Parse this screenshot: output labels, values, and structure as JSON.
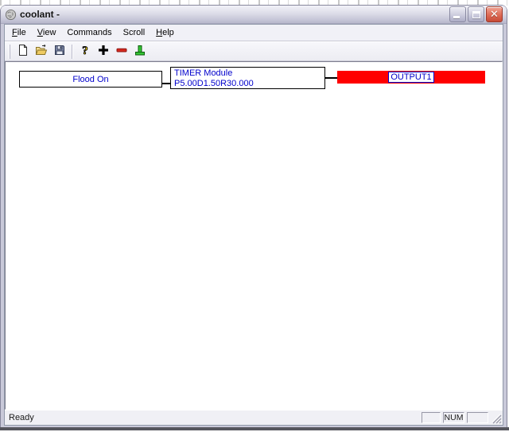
{
  "window": {
    "title": "coolant -",
    "controls": [
      {
        "name": "minimize",
        "icon": "minimize-icon"
      },
      {
        "name": "maximize",
        "icon": "maximize-icon"
      },
      {
        "name": "close",
        "icon": "close-icon"
      }
    ]
  },
  "menu": {
    "items": [
      {
        "label": "File",
        "mnemonic_index": 0
      },
      {
        "label": "View",
        "mnemonic_index": 0
      },
      {
        "label": "Commands",
        "mnemonic_index": -1
      },
      {
        "label": "Scroll",
        "mnemonic_index": -1
      },
      {
        "label": "Help",
        "mnemonic_index": 0
      }
    ]
  },
  "toolbar": {
    "buttons": [
      {
        "type": "button",
        "icon": "new-file-icon"
      },
      {
        "type": "button",
        "icon": "open-file-icon"
      },
      {
        "type": "button",
        "icon": "save-icon"
      },
      {
        "type": "separator"
      },
      {
        "type": "button",
        "icon": "help-icon"
      },
      {
        "type": "button",
        "icon": "add-block-icon"
      },
      {
        "type": "button",
        "icon": "remove-block-icon"
      },
      {
        "type": "button",
        "icon": "output-tee-icon"
      }
    ]
  },
  "diagram": {
    "input_node": {
      "label": "Flood On"
    },
    "timer_node": {
      "title": "TIMER Module",
      "params": "P5.00D1.50R30.000"
    },
    "output_node": {
      "label": "OUTPUT1"
    }
  },
  "statusbar": {
    "message": "Ready",
    "panels": [
      "",
      "NUM",
      ""
    ]
  },
  "colors": {
    "node_text_blue": "#0000CC",
    "output_bar_red": "#FF0000",
    "node_border": "#000000"
  }
}
